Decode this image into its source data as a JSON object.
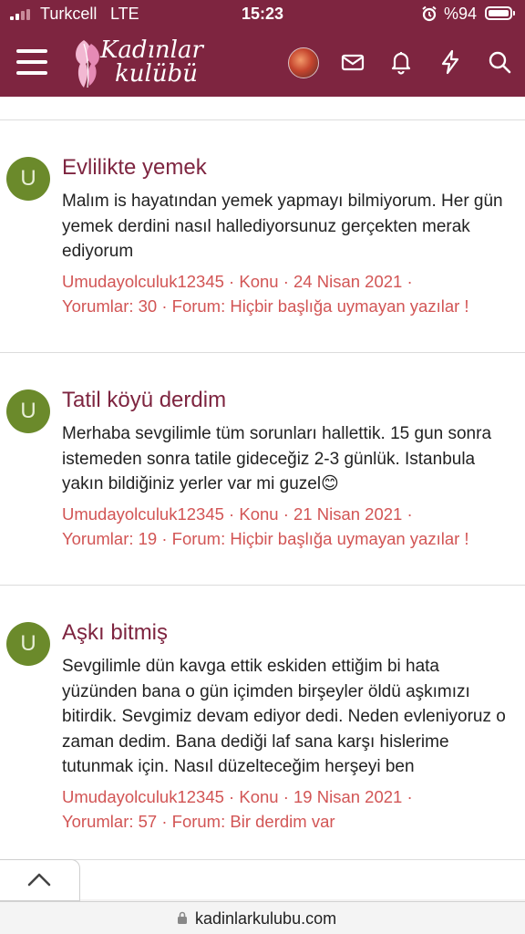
{
  "status": {
    "carrier": "Turkcell",
    "network": "LTE",
    "time": "15:23",
    "battery": "%94"
  },
  "header": {
    "logo_line1": "Kadınlar",
    "logo_line2": "kulübü"
  },
  "posts": [
    {
      "avatar_letter": "U",
      "title": "Evlilikte yemek",
      "snippet": "Malım is hayatından yemek yapmayı bilmiyorum. Her gün yemek derdini nasıl hallediyorsunuz gerçekten merak ediyorum",
      "meta_line1": "Umudayolculuk12345 · Konu · 24 Nisan 2021 ·",
      "meta_line2": "Yorumlar: 30 · Forum: Hiçbir başlığa uymayan yazılar !"
    },
    {
      "avatar_letter": "U",
      "title": "Tatil köyü derdim",
      "snippet": "Merhaba sevgilimle tüm sorunları hallettik. 15 gun sonra istemeden sonra tatile gideceğiz 2-3 günlük. Istanbula yakın bildiğiniz yerler var mi guzel😊",
      "meta_line1": "Umudayolculuk12345 · Konu · 21 Nisan 2021 ·",
      "meta_line2": "Yorumlar: 19 · Forum: Hiçbir başlığa uymayan yazılar !"
    },
    {
      "avatar_letter": "U",
      "title": "Aşkı bitmiş",
      "snippet": "Sevgilimle dün kavga ettik eskiden ettiğim bi hata yüzünden bana o gün içimden birşeyler öldü aşkımızı bitirdik. Sevgimiz devam ediyor dedi. Neden evleniyoruz o zaman dedim. Bana dediği laf sana karşı hislerime tutunmak için. Nasıl düzelteceğim herşeyi ben",
      "meta_line1": "Umudayolculuk12345 · Konu · 19 Nisan 2021 ·",
      "meta_line2": "Yorumlar: 57 · Forum: Bir derdim var"
    }
  ],
  "browser": {
    "url": "kadinlarkulubu.com"
  },
  "colors": {
    "brand": "#7e2540",
    "meta": "#d25555",
    "avatar": "#6b8a2b"
  }
}
